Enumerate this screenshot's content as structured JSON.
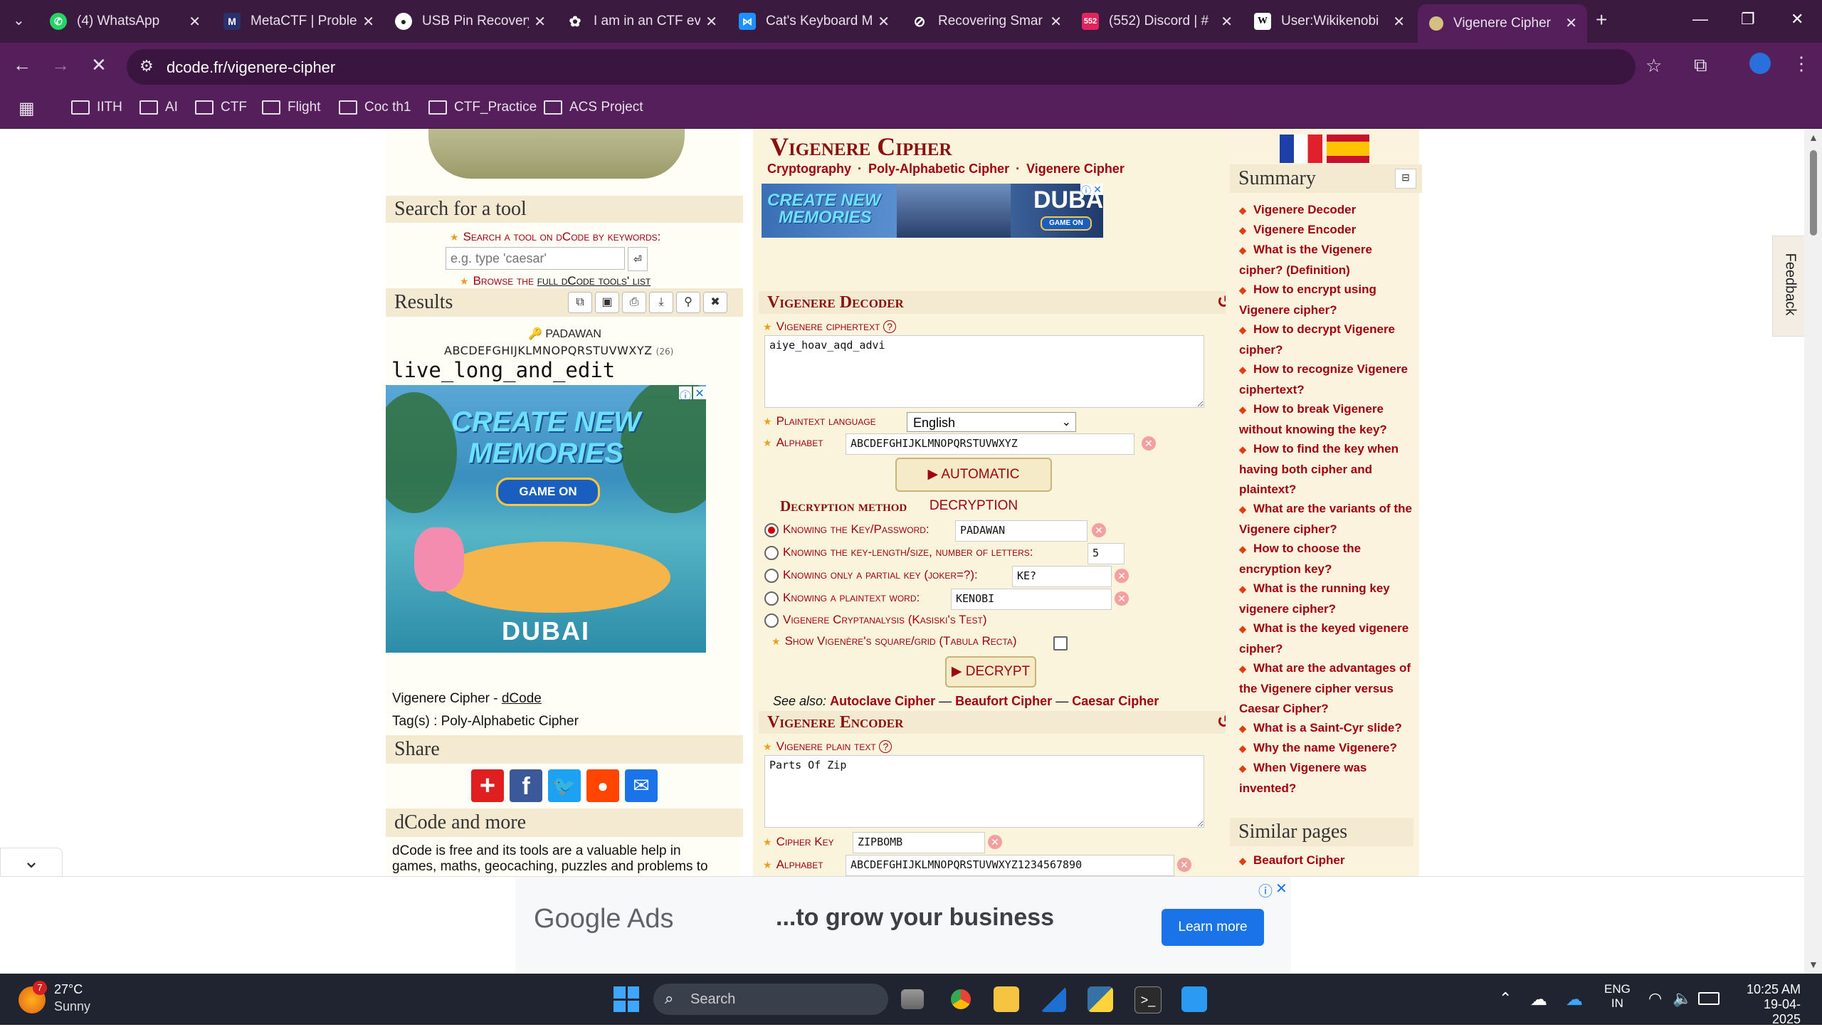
{
  "browser": {
    "tabs": [
      {
        "title": "(4) WhatsApp",
        "icon": "whatsapp-icon",
        "color": "#25d366"
      },
      {
        "title": "MetaCTF | Proble",
        "icon": "metactf-icon",
        "color": "#3a7bd5"
      },
      {
        "title": "USB Pin Recovery",
        "icon": "github-icon",
        "color": "#ffffff"
      },
      {
        "title": "I am in an CTF ev",
        "icon": "openai-icon",
        "color": "#ffffff"
      },
      {
        "title": "Cat's Keyboard M",
        "icon": "butterfly-icon",
        "color": "#1e90ff"
      },
      {
        "title": "Recovering Smar",
        "icon": "openai-icon",
        "color": "#ffffff"
      },
      {
        "title": "(552) Discord | #",
        "icon": "discord-icon",
        "color": "#e0245e"
      },
      {
        "title": "User:Wikikenobi",
        "icon": "wikipedia-icon",
        "color": "#ffffff"
      },
      {
        "title": "Vigenere Cipher",
        "icon": "dcode-icon",
        "color": "#d4c080"
      }
    ],
    "url": "dcode.fr/vigenere-cipher",
    "bookmarks": [
      "IITH",
      "AI",
      "CTF",
      "Flight",
      "Coc th1",
      "CTF_Practice",
      "ACS Project"
    ]
  },
  "left": {
    "search_title": "Search for a tool",
    "search_hint": "Search a tool on dCode by keywords:",
    "search_placeholder": "e.g. type 'caesar'",
    "browse_prefix": "Browse the",
    "browse_link": "full dCode tools' list",
    "results_title": "Results",
    "result_key": "PADAWAN",
    "result_alphabet": "ABCDEFGHIJKLMNOPQRSTUVWXYZ",
    "result_alphabet_count": "(26)",
    "result_text": "live_long_and_edit",
    "ad_headline1": "CREATE NEW",
    "ad_headline2": "MEMORIES",
    "ad_button": "GAME ON",
    "ad_brand": "DUBAI",
    "tool_name": "Vigenere Cipher - ",
    "tool_link": "dCode",
    "tags": "Tag(s) : Poly-Alphabetic Cipher",
    "share_title": "Share",
    "more_title": "dCode and more",
    "more_text": "dCode is free and its tools are a valuable help in games, maths, geocaching, puzzles and problems to"
  },
  "center": {
    "title": "Vigenere Cipher",
    "breadcrumb": [
      "Cryptography",
      "Poly-Alphabetic Cipher",
      "Vigenere Cipher"
    ],
    "banner_text1": "CREATE NEW",
    "banner_text2": "MEMORIES",
    "banner_brand": "DUBAI",
    "banner_button": "GAME ON",
    "decoder_title": "Vigenere Decoder",
    "ciphertext_label": "Vigenere ciphertext",
    "ciphertext_value": "aiye_hoav_aqd_advi",
    "plaintext_language_label": "Plaintext language",
    "language_value": "English",
    "alphabet_label": "Alphabet",
    "alphabet_value": "ABCDEFGHIJKLMNOPQRSTUVWXYZ",
    "auto_decrypt_button": "▶ AUTOMATIC DECRYPTION",
    "method_title": "Decryption method",
    "method_key_label": "Knowing the Key/Password:",
    "method_key_value": "PADAWAN",
    "method_length_label": "Knowing the key-length/size, number of letters:",
    "method_length_value": "5",
    "method_partial_label": "Knowing only a partial key (joker=?):",
    "method_partial_value": "KE?",
    "method_plain_label": "Knowing a plaintext word:",
    "method_plain_value": "KENOBI",
    "method_kasiski_label": "Vigenere Cryptanalysis (Kasiski's Test)",
    "show_grid_label": "Show Vigenère's square/grid (Tabula Recta)",
    "decrypt_button": "▶ DECRYPT",
    "see_also_prefix": "See also:",
    "see_also_links": [
      "Autoclave Cipher",
      "Beaufort Cipher",
      "Caesar Cipher"
    ],
    "see_also_sep": "—",
    "encoder_title": "Vigenere Encoder",
    "plaintext_label": "Vigenere plain text",
    "plaintext_value": "Parts Of Zip",
    "cipher_key_label": "Cipher Key",
    "cipher_key_value": "ZIPBOMB",
    "enc_alphabet_label": "Alphabet",
    "enc_alphabet_value": "ABCDEFGHIJKLMNOPQRSTUVWXYZ1234567890"
  },
  "right": {
    "summary_title": "Summary",
    "summary_links": [
      "Vigenere Decoder",
      "Vigenere Encoder",
      "What is the Vigenere cipher? (Definition)",
      "How to encrypt using Vigenere cipher?",
      "How to decrypt Vigenere cipher?",
      "How to recognize Vigenere ciphertext?",
      "How to break Vigenere without knowing the key?",
      "How to find the key when having both cipher and plaintext?",
      "What are the variants of the Vigenere cipher?",
      "How to choose the encryption key?",
      "What is the running key vigenere cipher?",
      "What is the keyed vigenere cipher?",
      "What are the advantages of the Vigenere cipher versus Caesar Cipher?",
      "What is a Saint-Cyr slide?",
      "Why the name Vigenere?",
      "When Vigenere was invented?"
    ],
    "similar_title": "Similar pages",
    "similar_links": [
      "Beaufort Cipher"
    ],
    "feedback": "Feedback"
  },
  "bottom_ad": {
    "brand": "Google Ads",
    "tagline": "...to grow your business",
    "button": "Learn more"
  },
  "taskbar": {
    "weather_temp": "27°C",
    "weather_desc": "Sunny",
    "weather_badge": "7",
    "search": "Search",
    "lang1": "ENG",
    "lang2": "IN",
    "time": "10:25 AM",
    "date": "19-04-2025"
  },
  "colors": {
    "chrome_dark": "#3b1a3f",
    "chrome": "#541f5b",
    "dcode_red": "#a0000f",
    "page_cream": "#fbf4dc"
  }
}
